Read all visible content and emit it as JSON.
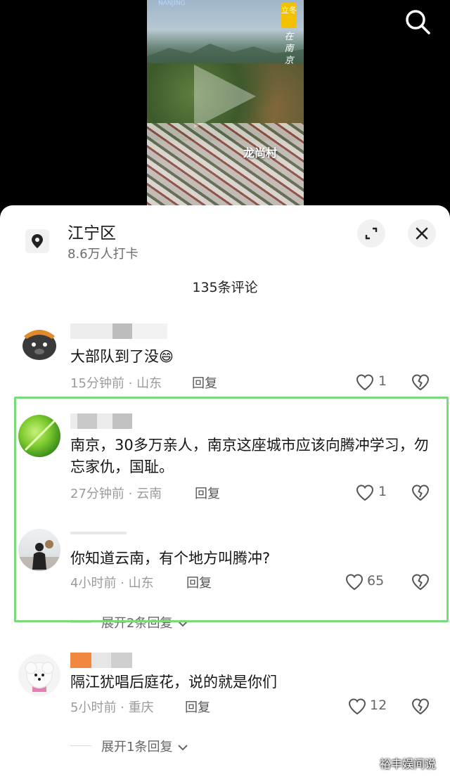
{
  "video": {
    "logo_text": "NANJING",
    "tag_text": "立冬",
    "vertical_text": "在南京",
    "caption": "龙尚村"
  },
  "location": {
    "name": "江宁区",
    "checkins": "8.6万人打卡"
  },
  "comment_count": "135条评论",
  "comments": [
    {
      "text": "大部队到了没",
      "time": "15分钟前",
      "region": "山东",
      "reply_label": "回复",
      "likes": "1",
      "emoji": "😄"
    },
    {
      "text": "南京，30多万亲人，南京这座城市应该向腾冲学习，勿忘家仇，国耻。",
      "time": "27分钟前",
      "region": "云南",
      "reply_label": "回复",
      "likes": "1"
    },
    {
      "text": "你知道云南，有个地方叫腾冲?",
      "time": "4小时前",
      "region": "山东",
      "reply_label": "回复",
      "likes": "65",
      "expand_label": "展开2条回复"
    },
    {
      "text": "隔江犹唱后庭花，说的就是你们",
      "time": "5小时前",
      "region": "重庆",
      "reply_label": "回复",
      "likes": "12",
      "expand_label": "展开1条回复"
    }
  ],
  "meta_separator": "·",
  "colors": {
    "highlight": "#7bd97a",
    "sheet": "#ffffff"
  },
  "watermark": "裕丰娱间说"
}
